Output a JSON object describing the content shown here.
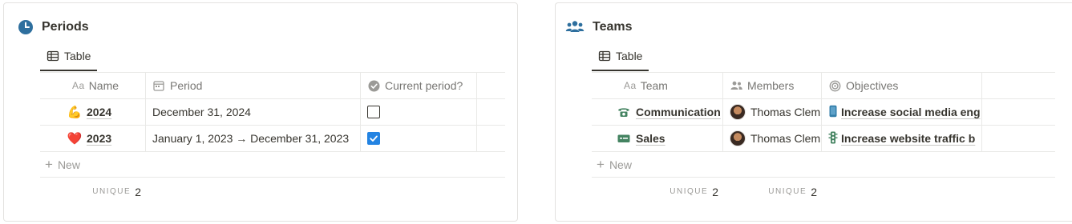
{
  "periods": {
    "title": "Periods",
    "tab_label": "Table",
    "columns": {
      "name": "Name",
      "name_prefix": "Aa",
      "period": "Period",
      "current": "Current period?"
    },
    "rows": [
      {
        "emoji": "💪",
        "name": "2024",
        "period": "December 31, 2024",
        "current": false
      },
      {
        "emoji": "❤️",
        "name": "2023",
        "period": "January 1, 2023 → December 31, 2023",
        "current": true
      }
    ],
    "new_label": "New",
    "calc": {
      "label": "UNIQUE",
      "value": "2"
    }
  },
  "teams": {
    "title": "Teams",
    "tab_label": "Table",
    "columns": {
      "team": "Team",
      "team_prefix": "Aa",
      "members": "Members",
      "objectives": "Objectives"
    },
    "rows": [
      {
        "icon": "phone-icon",
        "name": "Communication",
        "member": "Thomas Clem",
        "objective_icon": "phone-device-icon",
        "objective": "Increase social media eng"
      },
      {
        "icon": "money-icon",
        "name": "Sales",
        "member": "Thomas Clem",
        "objective_icon": "traffic-light-icon",
        "objective": "Increase website traffic b"
      }
    ],
    "new_label": "New",
    "calc_members": {
      "label": "UNIQUE",
      "value": "2"
    },
    "calc_objectives": {
      "label": "UNIQUE",
      "value": "2"
    }
  },
  "colors": {
    "accent_blue": "#2383e2",
    "periods_icon": "#2e6f9e",
    "teams_icon": "#2e6f9e",
    "team_icon_green": "#448361",
    "objective_blue": "#337ea9"
  }
}
